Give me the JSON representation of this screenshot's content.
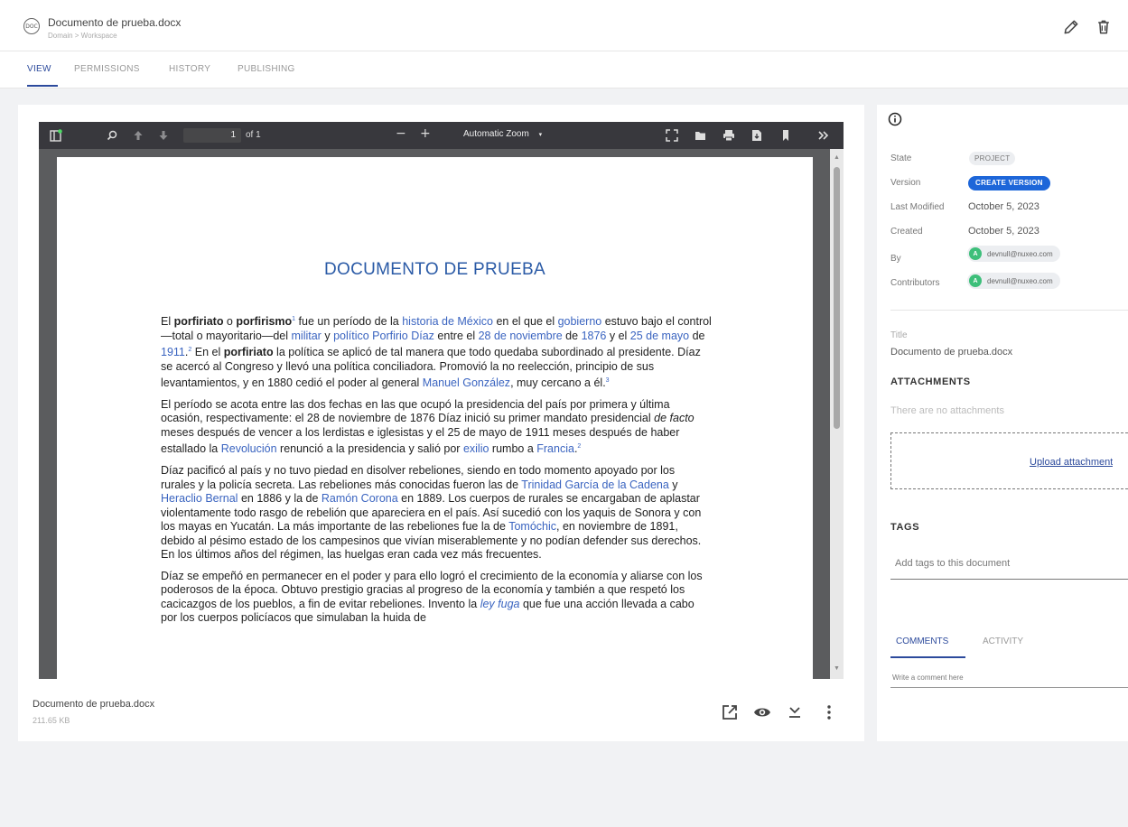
{
  "header": {
    "doc_icon_text": "DOC",
    "title": "Documento de prueba.docx",
    "breadcrumb": "Domain > Workspace"
  },
  "tabs": [
    {
      "label": "VIEW"
    },
    {
      "label": "PERMISSIONS"
    },
    {
      "label": "HISTORY"
    },
    {
      "label": "PUBLISHING"
    }
  ],
  "viewer": {
    "page_number": "1",
    "page_of": "of 1",
    "zoom": "Automatic Zoom",
    "zoom_minus": "−",
    "zoom_plus": "+"
  },
  "document": {
    "heading": "DOCUMENTO DE PRUEBA",
    "p1": [
      {
        "t": "El "
      },
      {
        "t": "porfiriato",
        "b": true
      },
      {
        "t": " o "
      },
      {
        "t": "porfirismo",
        "b": true
      },
      {
        "t": "1",
        "sup": true
      },
      {
        "t": " fue un período de la "
      },
      {
        "t": "historia de México",
        "link": true
      },
      {
        "t": " en el que el "
      },
      {
        "t": "gobierno",
        "link": true
      },
      {
        "t": " estuvo bajo el control —total o mayoritario—del "
      },
      {
        "t": "militar",
        "link": true
      },
      {
        "t": " y "
      },
      {
        "t": "político",
        "link": true
      },
      {
        "t": " "
      },
      {
        "t": "Porfirio Díaz",
        "link": true
      },
      {
        "t": " entre el "
      },
      {
        "t": "28 de noviembre",
        "link": true
      },
      {
        "t": " de "
      },
      {
        "t": "1876",
        "link": true
      },
      {
        "t": " y el "
      },
      {
        "t": "25 de mayo",
        "link": true
      },
      {
        "t": " de "
      },
      {
        "t": "1911",
        "link": true
      },
      {
        "t": ".",
        "link": false
      },
      {
        "t": "2",
        "sup": true
      },
      {
        "t": " En el "
      },
      {
        "t": "porfiriato",
        "b": true
      },
      {
        "t": " la política se aplicó de tal manera que todo quedaba subordinado al presidente. Díaz se acercó al Congreso y llevó una política conciliadora. Promovió la no reelección, principio de sus levantamientos, y en 1880 cedió el poder al general "
      },
      {
        "t": "Manuel González",
        "link": true
      },
      {
        "t": ", muy cercano a él."
      },
      {
        "t": "3",
        "sup": true
      }
    ],
    "p2": [
      {
        "t": "El período se acota entre las dos fechas en las que ocupó la presidencia del país por primera y última ocasión, respectivamente: el 28 de noviembre de 1876 Díaz inició su primer mandato presidencial "
      },
      {
        "t": "de facto",
        "i": true
      },
      {
        "t": " meses después de vencer a los lerdistas e iglesistas y el 25 de mayo de 1911 meses después de haber estallado la "
      },
      {
        "t": "Revolución",
        "link": true
      },
      {
        "t": " renunció a la presidencia y salió por "
      },
      {
        "t": "exilio",
        "link": true
      },
      {
        "t": " rumbo a "
      },
      {
        "t": "Francia",
        "link": true
      },
      {
        "t": "."
      },
      {
        "t": "2",
        "sup": true
      }
    ],
    "p3": [
      {
        "t": "Díaz pacificó al país y no tuvo piedad en disolver rebeliones, siendo en todo momento apoyado por los rurales y la policía secreta. Las rebeliones más conocidas fueron las de "
      },
      {
        "t": "Trinidad García de la Cadena",
        "link": true
      },
      {
        "t": " y "
      },
      {
        "t": "Heraclio Bernal",
        "link": true
      },
      {
        "t": " en 1886 y la de "
      },
      {
        "t": "Ramón Corona",
        "link": true
      },
      {
        "t": " en 1889. Los cuerpos de rurales se encargaban de aplastar violentamente todo rasgo de rebelión que apareciera en el país. Así sucedió con los yaquis de Sonora y con los mayas en Yucatán. La más importante de las rebeliones fue la de "
      },
      {
        "t": "Tomóchic",
        "link": true
      },
      {
        "t": ", en noviembre de 1891, debido al pésimo estado de los campesinos que vivían miserablemente y no podían defender sus derechos. En los últimos años del régimen, las huelgas eran cada vez más frecuentes."
      }
    ],
    "p4": [
      {
        "t": "Díaz se empeñó en permanecer en el poder y para ello logró el crecimiento de la economía y aliarse con los poderosos de la época. Obtuvo prestigio gracias al progreso de la economía y también a que respetó los cacicazgos de los pueblos, a fin de evitar rebeliones. Invento la "
      },
      {
        "t": "ley fuga",
        "link": true,
        "i": true
      },
      {
        "t": " que fue una acción llevada a cabo por los cuerpos policíacos que simulaban la huida de"
      }
    ]
  },
  "file": {
    "name": "Documento de prueba.docx",
    "size": "211.65 KB"
  },
  "info": {
    "state_label": "State",
    "state_value": "PROJECT",
    "version_label": "Version",
    "version_button": "CREATE VERSION",
    "last_modified_label": "Last Modified",
    "last_modified_value": "October 5, 2023",
    "created_label": "Created",
    "created_value": "October 5, 2023",
    "by_label": "By",
    "by_user": "devnull@nuxeo.com",
    "contributors_label": "Contributors",
    "contributor_user": "devnull@nuxeo.com",
    "avatar_letter": "A",
    "title_label": "Title",
    "title_value": "Documento de prueba.docx"
  },
  "attachments": {
    "heading": "ATTACHMENTS",
    "empty": "There are no attachments",
    "upload": "Upload attachment"
  },
  "tags": {
    "heading": "TAGS",
    "placeholder": "Add tags to this document"
  },
  "comments": {
    "tab_comments": "COMMENTS",
    "tab_activity": "ACTIVITY",
    "placeholder": "Write a comment here"
  },
  "colors": {
    "accent": "#2c4a9c",
    "version_badge": "#1d66d9",
    "avatar": "#3dbf7a",
    "link": "#3a64c0"
  }
}
